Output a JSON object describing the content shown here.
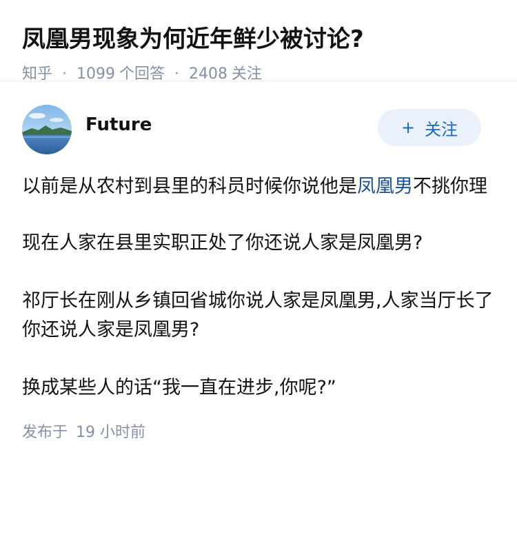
{
  "question": {
    "title": "凤凰男现象为何近年鲜少被讨论?",
    "source": "知乎",
    "answers_count": "1099",
    "answers_label": "个回答",
    "followers_count": "2408",
    "followers_label": "关注",
    "separator": "·"
  },
  "answer": {
    "author": {
      "name": "Future",
      "avatar_icon": "avatar-landscape-icon"
    },
    "follow_button": {
      "plus": "+",
      "label": "关注"
    },
    "paragraphs": [
      {
        "before": "以前是从农村到县里的科员时候你说他是",
        "link": "凤凰男",
        "after": "不挑你理"
      },
      {
        "text": "现在人家在县里实职正处了你还说人家是凤凰男?"
      },
      {
        "text": "祁厅长在刚从乡镇回省城你说人家是凤凰男,人家当厅长了你还说人家是凤凰男?"
      },
      {
        "text": "换成某些人的话“我一直在进步,你呢?”"
      }
    ],
    "published_label": "发布于",
    "published_time": "19 小时前"
  },
  "colors": {
    "title": "#121212",
    "meta": "#8590a6",
    "link": "#175199",
    "follow_bg": "#ebf1fb",
    "follow_text": "#1a66c6"
  }
}
